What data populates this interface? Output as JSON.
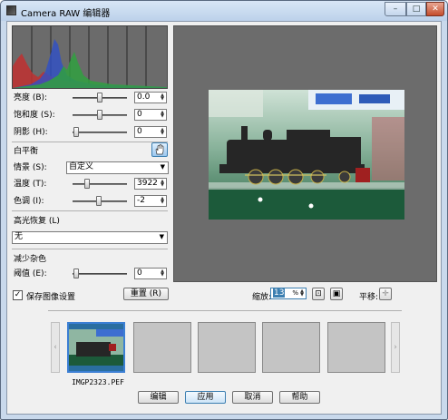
{
  "window": {
    "title": "Camera RAW 编辑器",
    "min_label": "–",
    "max_label": "□",
    "close_label": "✕"
  },
  "adjust": {
    "brightness": {
      "label": "亮度 (B):",
      "value": "0.0"
    },
    "saturation": {
      "label": "饱和度 (S):",
      "value": "0"
    },
    "shadow": {
      "label": "阴影 (H):",
      "value": "0"
    }
  },
  "white_balance": {
    "heading": "白平衡",
    "scene_label": "情景 (S):",
    "scene_value": "自定义",
    "temperature": {
      "label": "温度 (T):",
      "value": "3922"
    },
    "tint": {
      "label": "色调 (I):",
      "value": "-2"
    }
  },
  "highlight": {
    "heading": "高光恢复 (L)",
    "value": "无"
  },
  "noise": {
    "heading": "减少杂色",
    "threshold": {
      "label": "阈值 (E):",
      "value": "0"
    }
  },
  "save_settings": {
    "label": "保存图像设置",
    "checked": true
  },
  "reset_label": "重置 (R)",
  "zoom": {
    "label": "缩放:",
    "value": "13"
  },
  "pan_label": "平移:",
  "thumbnail": {
    "filename": "IMGP2323.PEF"
  },
  "footer": {
    "edit": "编辑",
    "apply": "应用",
    "cancel": "取消",
    "help": "帮助"
  }
}
